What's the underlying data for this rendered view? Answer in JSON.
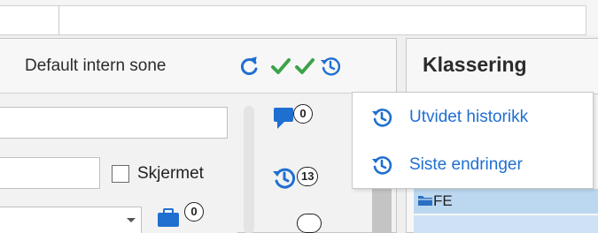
{
  "colors": {
    "accent_blue": "#1f6fd1",
    "check_green": "#3ca34a",
    "selection_blue": "#bcd7f0"
  },
  "header": {
    "zone_label": "Default intern sone",
    "icons": [
      "refresh-icon",
      "check-icon",
      "check-icon",
      "history-icon"
    ]
  },
  "form": {
    "checkbox_label": "Skjermet",
    "checkbox_checked": false,
    "doc_badge_count": "0"
  },
  "side": {
    "comment_count": "0",
    "activity_count": "13"
  },
  "right_panel": {
    "title": "Klassering",
    "list_item_label": "FE"
  },
  "history_menu": {
    "items": [
      {
        "label": "Utvidet historikk",
        "icon": "history-icon"
      },
      {
        "label": "Siste endringer",
        "icon": "history-icon"
      }
    ]
  }
}
